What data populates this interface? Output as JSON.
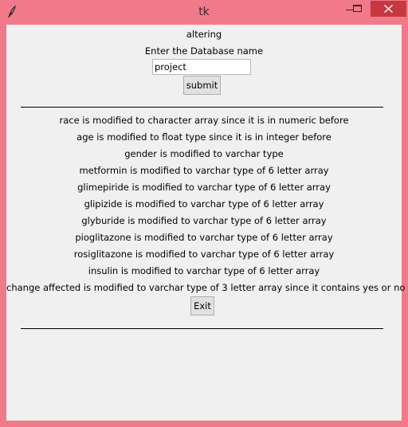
{
  "window": {
    "title": "tk"
  },
  "form": {
    "heading": "altering",
    "prompt": "Enter the Database name",
    "db_name_value": "project",
    "submit_label": "submit"
  },
  "messages": [
    "race is modified to character array since it is in numeric before",
    "age is modified to float type since it is in integer before",
    "gender is modified to varchar type",
    "metformin is modified to varchar type of 6 letter array",
    "glimepiride is modified to varchar type of 6 letter array",
    "glipizide is modified to varchar type of 6 letter array",
    "glyburide is modified to varchar type of 6 letter array",
    "pioglitazone is modified to varchar type of 6 letter array",
    "rosiglitazone is modified to varchar type of 6 letter array",
    "insulin is modified to varchar type of 6 letter array",
    "change affected is modified to varchar type of 3 letter array since it contains yes or no"
  ],
  "exit_label": "Exit",
  "icons": {
    "app": "feather-icon",
    "minimize": "minimize-icon",
    "maximize": "maximize-icon",
    "close": "close-icon"
  },
  "colors": {
    "titlebar": "#f07a8a",
    "close_button": "#c7373f",
    "client_background": "#f0f0f0",
    "button_face": "#e1e1e1"
  }
}
